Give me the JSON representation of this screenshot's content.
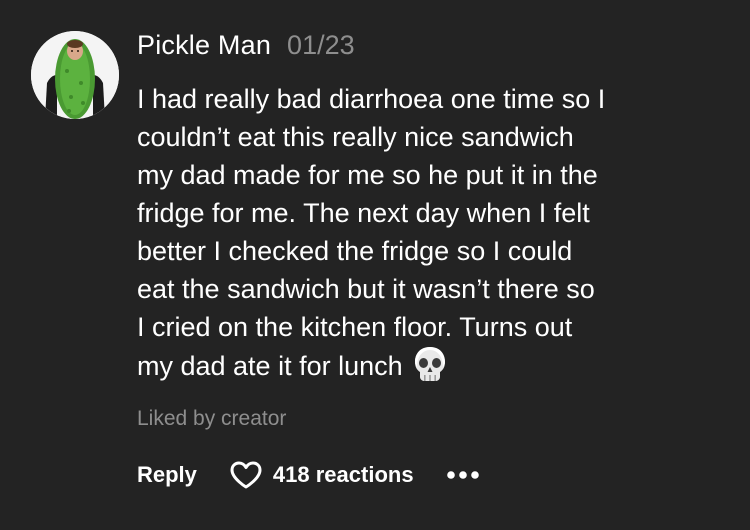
{
  "comment": {
    "username": "Pickle Man",
    "date": "01/23",
    "text_lines": [
      "I had really bad diarrhoea one time so I",
      "couldn’t eat this really nice sandwich",
      "my dad made for me so he put it in the",
      "fridge for me. The next day when I felt",
      "better I checked the fridge so I could",
      "eat the sandwich but it wasn’t there so",
      "I cried on the kitchen floor. Turns out",
      "my dad ate it for lunch"
    ],
    "emoji": "skull-emoji",
    "liked_by": "Liked by creator",
    "reply_label": "Reply",
    "reactions_label": "418 reactions",
    "avatar_icon": "pickle-costume-avatar",
    "like_icon": "heart-outline-icon",
    "more_icon": "more-options-icon"
  },
  "colors": {
    "background": "#232323",
    "primary_text": "#ffffff",
    "secondary_text": "#8e8e8e"
  }
}
